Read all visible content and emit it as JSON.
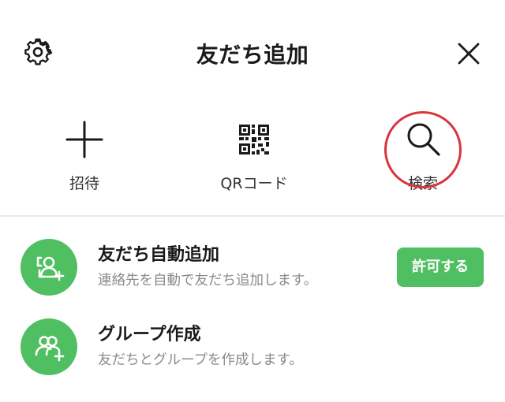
{
  "header": {
    "title": "友だち追加"
  },
  "actions": [
    {
      "label": "招待",
      "icon": "plus-icon"
    },
    {
      "label": "QRコード",
      "icon": "qr-code-icon"
    },
    {
      "label": "検索",
      "icon": "search-icon"
    }
  ],
  "options": [
    {
      "title": "友だち自動追加",
      "subtitle": "連絡先を自動で友だち追加します。",
      "icon": "auto-add-friend-icon",
      "button_label": "許可する"
    },
    {
      "title": "グループ作成",
      "subtitle": "友だちとグループを作成します。",
      "icon": "create-group-icon"
    }
  ],
  "colors": {
    "accent_green": "#50bf61",
    "highlight_red": "#d9343b"
  }
}
